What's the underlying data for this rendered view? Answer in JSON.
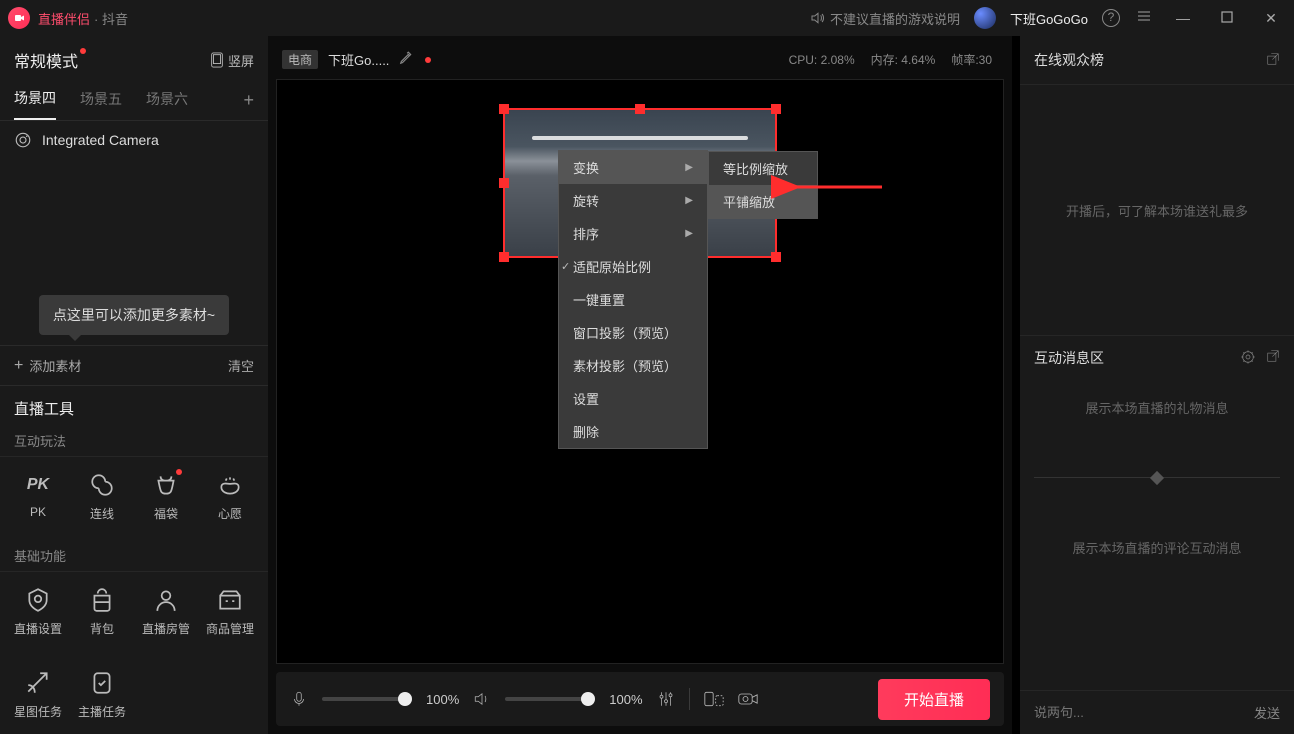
{
  "titlebar": {
    "brand": "直播伴侣",
    "subbrand": "· 抖音",
    "notice": "不建议直播的游戏说明",
    "username": "下班GoGoGo"
  },
  "sidebar": {
    "mode": "常规模式",
    "orient": "竖屏",
    "scenes": {
      "tabs": [
        "场景四",
        "场景五",
        "场景六"
      ],
      "active": 0
    },
    "source": "Integrated Camera",
    "tip": "点这里可以添加更多素材~",
    "add": "添加素材",
    "clear": "清空",
    "tools_title": "直播工具",
    "interact_head": "互动玩法",
    "interact": [
      {
        "label": "PK",
        "badge": "PK"
      },
      {
        "label": "连线"
      },
      {
        "label": "福袋"
      },
      {
        "label": "心愿"
      }
    ],
    "basic_head": "基础功能",
    "basic": [
      {
        "label": "直播设置"
      },
      {
        "label": "背包"
      },
      {
        "label": "直播房管"
      },
      {
        "label": "商品管理"
      }
    ],
    "tasks": [
      {
        "label": "星图任务"
      },
      {
        "label": "主播任务"
      }
    ]
  },
  "stage": {
    "tag": "电商",
    "title": "下班Go.....",
    "cpu": "CPU: 2.08%",
    "mem": "内存: 4.64%",
    "fps": "帧率:30"
  },
  "ctx": {
    "items": [
      "变换",
      "旋转",
      "排序",
      "适配原始比例",
      "一键重置",
      "窗口投影（预览）",
      "素材投影（预览）",
      "设置",
      "删除"
    ],
    "sub": [
      "等比例缩放",
      "平铺缩放"
    ]
  },
  "bottom": {
    "vol1": "100%",
    "vol2": "100%",
    "start": "开始直播"
  },
  "right": {
    "panel1_title": "在线观众榜",
    "panel1_msg": "开播后，可了解本场谁送礼最多",
    "panel2_title": "互动消息区",
    "gift_msg": "展示本场直播的礼物消息",
    "chat_msg": "展示本场直播的评论互动消息",
    "input_placeholder": "说两句...",
    "send": "发送"
  }
}
